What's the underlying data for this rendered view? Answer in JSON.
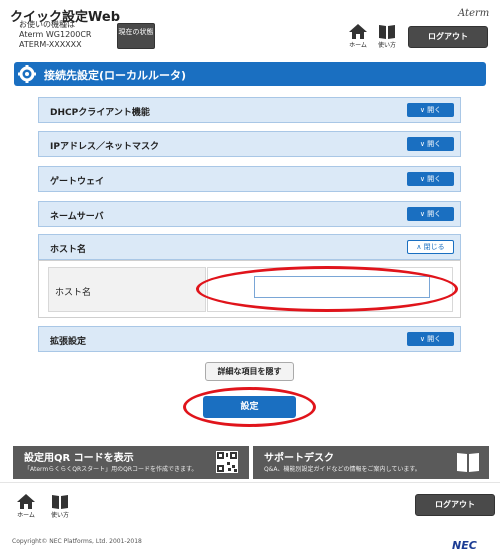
{
  "header": {
    "app_title": "クイック設定Web",
    "device_label": "お使いの機種は",
    "device_model": "Aterm WG1200CR",
    "device_id": "ATERM-XXXXXX",
    "status_button": "現在の状態",
    "home_label": "ホーム",
    "usage_label": "使い方",
    "logout_label": "ログアウト",
    "brand": "Aterm"
  },
  "page_title": "接続先設定(ローカルルータ)",
  "sections": [
    {
      "label": "DHCPクライアント機能",
      "toggle": "開く"
    },
    {
      "label": "IPアドレス／ネットマスク",
      "toggle": "開く"
    },
    {
      "label": "ゲートウェイ",
      "toggle": "開く"
    },
    {
      "label": "ネームサーバ",
      "toggle": "開く"
    },
    {
      "label": "ホスト名",
      "toggle": "閉じる"
    },
    {
      "label": "拡張設定",
      "toggle": "開く"
    }
  ],
  "host_form": {
    "field_label": "ホスト名",
    "value": ""
  },
  "buttons": {
    "hide_details": "詳細な項目を隠す",
    "apply": "設定"
  },
  "cards": {
    "qr_title": "設定用QR コードを表示",
    "qr_sub": "「AtermらくらくQRスタート」用のQRコードを作成できます。",
    "support_title": "サポートデスク",
    "support_sub": "Q&A、機能別設定ガイドなどの情報をご案内しています。"
  },
  "footer": {
    "home_label": "ホーム",
    "usage_label": "使い方",
    "logout_label": "ログアウト",
    "copyright": "Copyright© NEC Platforms, Ltd. 2001-2018",
    "brand": "NEC"
  },
  "colors": {
    "accent": "#1a6fc1",
    "highlight": "#e0141b",
    "section_bg": "#dbe9f7",
    "dark_button": "#4a4a4a"
  }
}
